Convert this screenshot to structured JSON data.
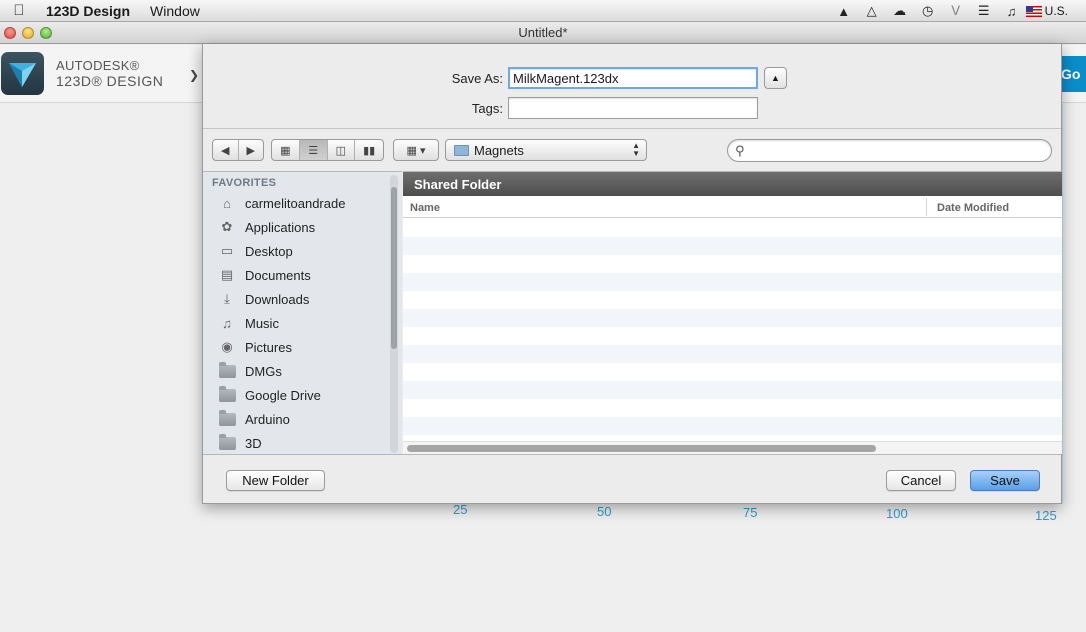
{
  "menubar": {
    "app_name": "123D Design",
    "menus": [
      "Window"
    ],
    "locale": "U.S."
  },
  "window": {
    "title": "Untitled*"
  },
  "app": {
    "brand_line1": "AUTODESK®",
    "brand_line2": "123D® DESIGN",
    "go_button": "Go F",
    "axis_labels": [
      "25",
      "50",
      "75",
      "100",
      "125"
    ]
  },
  "dialog": {
    "save_as_label": "Save As:",
    "save_as_value": "MilkMagent.123dx",
    "tags_label": "Tags:",
    "tags_value": "",
    "location": "Magnets",
    "search_placeholder": "",
    "sidebar_header": "FAVORITES",
    "sidebar_items": [
      {
        "label": "carmelitoandrade",
        "icon": "home-icon"
      },
      {
        "label": "Applications",
        "icon": "applications-icon"
      },
      {
        "label": "Desktop",
        "icon": "desktop-icon"
      },
      {
        "label": "Documents",
        "icon": "documents-icon"
      },
      {
        "label": "Downloads",
        "icon": "downloads-icon"
      },
      {
        "label": "Music",
        "icon": "music-icon"
      },
      {
        "label": "Pictures",
        "icon": "pictures-icon"
      },
      {
        "label": "DMGs",
        "icon": "folder-icon"
      },
      {
        "label": "Google Drive",
        "icon": "folder-icon"
      },
      {
        "label": "Arduino",
        "icon": "folder-icon"
      },
      {
        "label": "3D",
        "icon": "folder-icon"
      }
    ],
    "folder_banner": "Shared Folder",
    "columns": {
      "name": "Name",
      "date_modified": "Date Modified"
    },
    "buttons": {
      "new_folder": "New Folder",
      "cancel": "Cancel",
      "save": "Save"
    }
  }
}
